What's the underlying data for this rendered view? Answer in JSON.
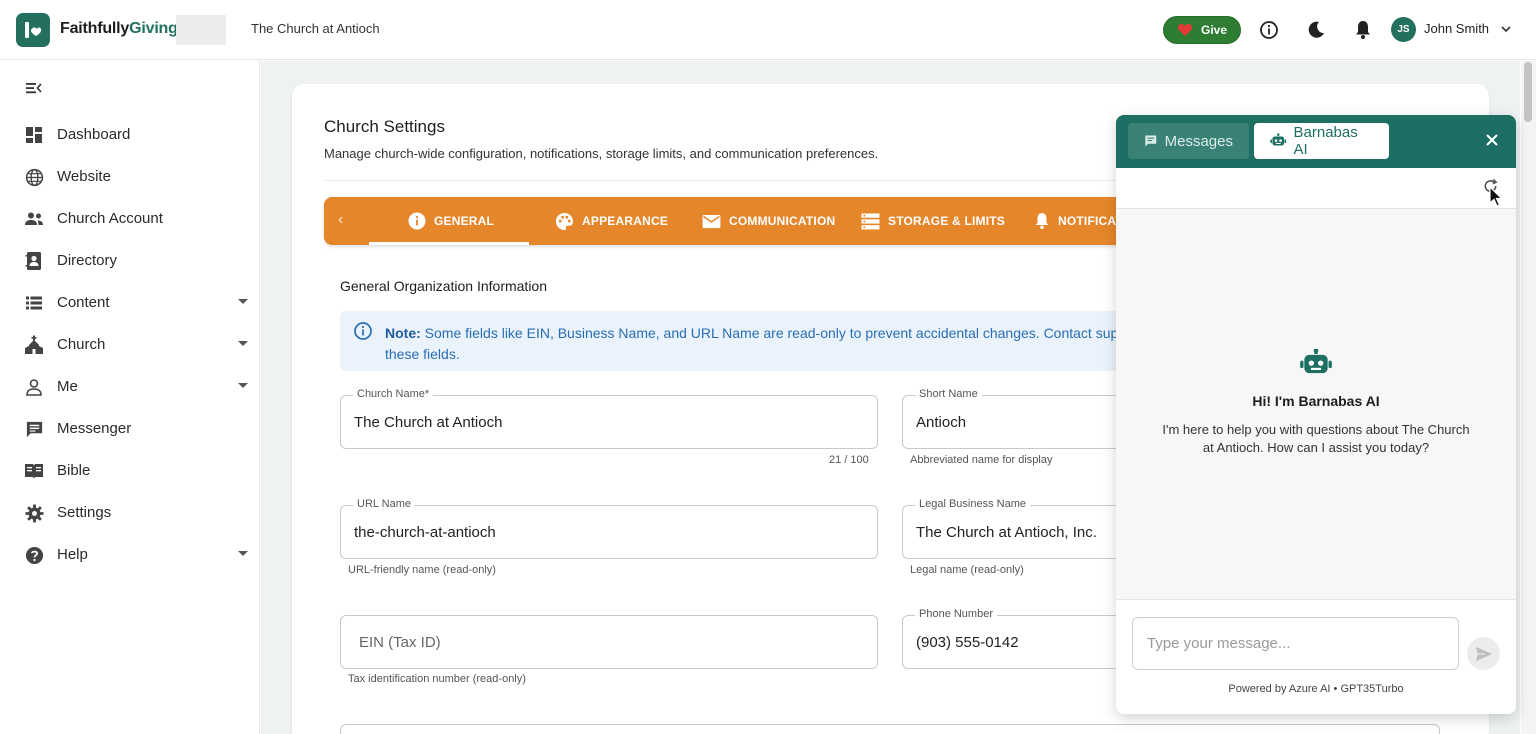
{
  "topbar": {
    "brand_part1": "Faithfully",
    "brand_part2": "Giving",
    "church_name": "The Church at Antioch",
    "give_label": "Give",
    "user_initials": "JS",
    "user_name": "John Smith"
  },
  "sidebar": {
    "items": [
      {
        "label": "Dashboard",
        "icon": "dashboard-icon"
      },
      {
        "label": "Website",
        "icon": "globe-icon"
      },
      {
        "label": "Church Account",
        "icon": "people-icon"
      },
      {
        "label": "Directory",
        "icon": "contact-book-icon"
      },
      {
        "label": "Content",
        "icon": "list-icon",
        "expandable": true
      },
      {
        "label": "Church",
        "icon": "church-icon",
        "expandable": true
      },
      {
        "label": "Me",
        "icon": "person-icon",
        "expandable": true
      },
      {
        "label": "Messenger",
        "icon": "chat-icon"
      },
      {
        "label": "Bible",
        "icon": "book-icon"
      },
      {
        "label": "Settings",
        "icon": "gear-icon"
      },
      {
        "label": "Help",
        "icon": "help-icon",
        "expandable": true
      }
    ]
  },
  "page": {
    "title": "Church Settings",
    "subtitle": "Manage church-wide configuration, notifications, storage limits, and communication preferences.",
    "tabs": [
      {
        "label": "GENERAL",
        "icon": "info-icon",
        "active": true
      },
      {
        "label": "APPEARANCE",
        "icon": "palette-icon"
      },
      {
        "label": "COMMUNICATION",
        "icon": "mail-icon"
      },
      {
        "label": "STORAGE & LIMITS",
        "icon": "storage-icon"
      },
      {
        "label": "NOTIFICATIONS",
        "icon": "bell-icon"
      }
    ],
    "section_title": "General Organization Information",
    "note_label": "Note:",
    "note_text": "Some fields like EIN, Business Name, and URL Name are read-only to prevent accidental changes. Contact support to update these fields.",
    "fields": {
      "church_name": {
        "label": "Church Name*",
        "value": "The Church at Antioch",
        "counter": "21 / 100"
      },
      "short_name": {
        "label": "Short Name",
        "value": "Antioch",
        "helper": "Abbreviated name for display"
      },
      "url_name": {
        "label": "URL Name",
        "value": "the-church-at-antioch",
        "helper": "URL-friendly name (read-only)"
      },
      "legal_name": {
        "label": "Legal Business Name",
        "value": "The Church at Antioch, Inc.",
        "helper": "Legal name (read-only)"
      },
      "ein": {
        "placeholder": "EIN (Tax ID)",
        "helper": "Tax identification number (read-only)"
      },
      "phone": {
        "label": "Phone Number",
        "value": "(903) 555-0142"
      }
    }
  },
  "chat": {
    "tab_messages": "Messages",
    "tab_ai": "Barnabas AI",
    "greeting": "Hi! I'm Barnabas AI",
    "intro": "I'm here to help you with questions about The Church at Antioch. How can I assist you today?",
    "input_placeholder": "Type your message...",
    "powered_by": "Powered by Azure AI • GPT35Turbo"
  },
  "colors": {
    "brand_green": "#23705f",
    "tab_orange": "#e6862a",
    "give_green": "#2e7d32",
    "chat_header": "#1d6f63",
    "note_blue": "#2a6db5"
  }
}
